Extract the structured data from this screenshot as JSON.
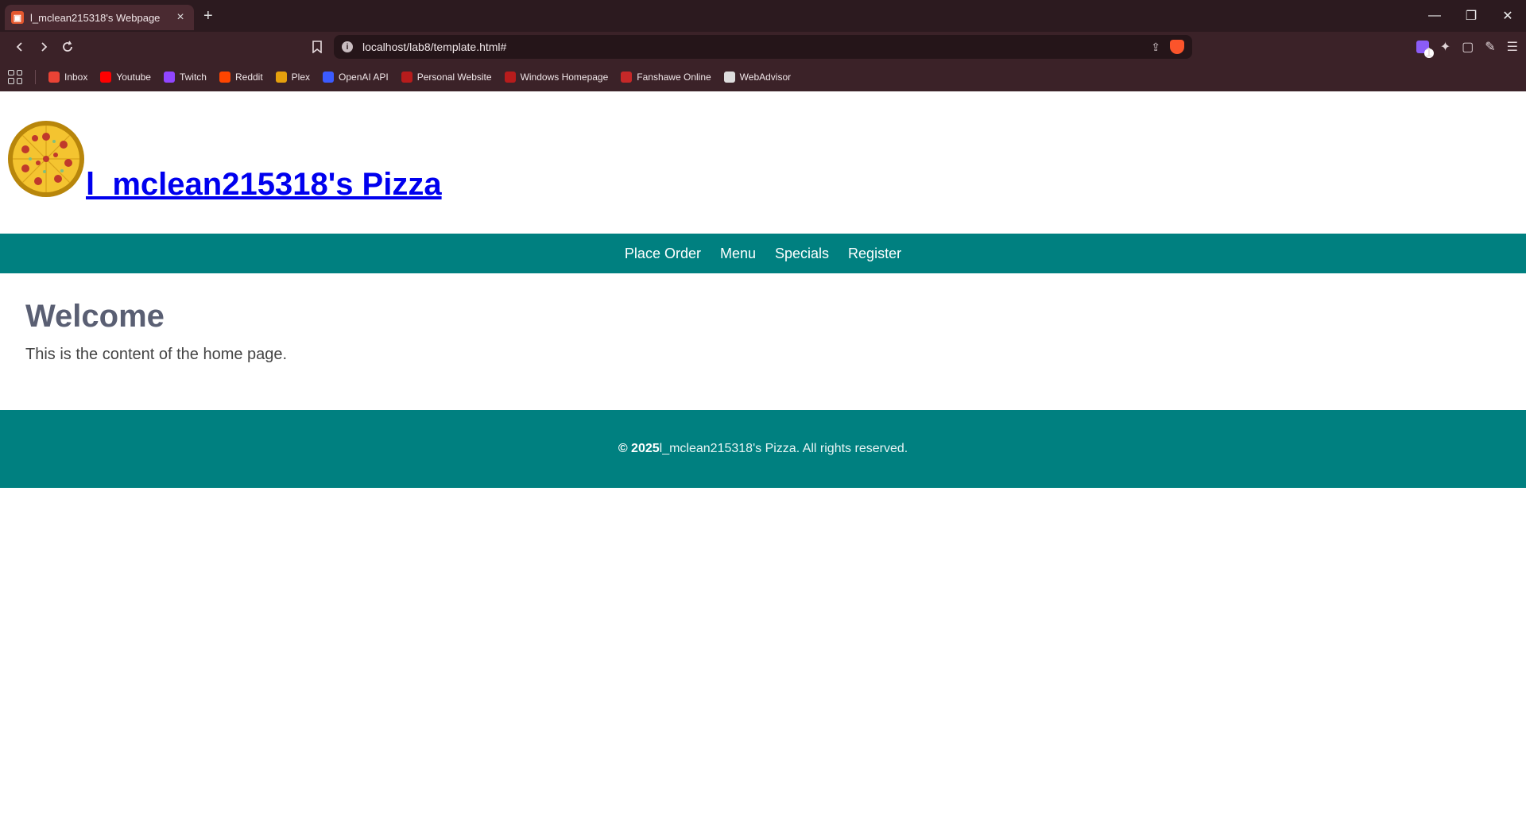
{
  "browser": {
    "tab_title": "l_mclean215318's Webpage",
    "tab_close": "×",
    "new_tab": "+",
    "url": "localhost/lab8/template.html#",
    "wallet_badge": "1",
    "window_controls": [
      "—",
      "❐",
      "✕"
    ],
    "bookmarks": [
      {
        "label": "Inbox",
        "icon": "gmail-icon",
        "color": "#ea4335"
      },
      {
        "label": "Youtube",
        "icon": "youtube-icon",
        "color": "#ff0000"
      },
      {
        "label": "Twitch",
        "icon": "twitch-icon",
        "color": "#9146ff"
      },
      {
        "label": "Reddit",
        "icon": "reddit-icon",
        "color": "#ff4500"
      },
      {
        "label": "Plex",
        "icon": "plex-icon",
        "color": "#e5a00d"
      },
      {
        "label": "OpenAI API",
        "icon": "openai-icon",
        "color": "#3b5bff"
      },
      {
        "label": "Personal Website",
        "icon": "personal-website-icon",
        "color": "#b71c1c"
      },
      {
        "label": "Windows Homepage",
        "icon": "windows-homepage-icon",
        "color": "#b71c1c"
      },
      {
        "label": "Fanshawe Online",
        "icon": "fanshawe-icon",
        "color": "#c62828"
      },
      {
        "label": "WebAdvisor",
        "icon": "webadvisor-icon",
        "color": "#dddddd"
      }
    ]
  },
  "site": {
    "title": " l_mclean215318's Pizza",
    "nav": [
      "Place Order",
      "Menu",
      "Specials",
      "Register"
    ],
    "main_heading": "Welcome",
    "main_text": "This is the content of the home page.",
    "footer_year": "© 2025",
    "footer_text": "l_mclean215318's Pizza. All rights reserved.",
    "colors": {
      "nav_bg": "#008080",
      "link": "#0000ee",
      "heading": "#5a5f73"
    }
  }
}
